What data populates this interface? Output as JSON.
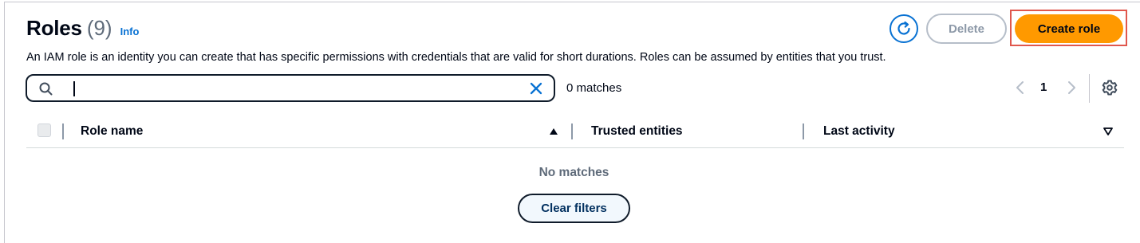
{
  "header": {
    "title": "Roles",
    "count": "(9)",
    "info_label": "Info",
    "description": "An IAM role is an identity you can create that has specific permissions with credentials that are valid for short durations. Roles can be assumed by entities that you trust."
  },
  "actions": {
    "refresh_icon": "refresh-icon",
    "delete_label": "Delete",
    "create_label": "Create role"
  },
  "search": {
    "value": "",
    "placeholder": "",
    "matches_text": "0 matches"
  },
  "pagination": {
    "current_page": "1"
  },
  "table": {
    "columns": [
      {
        "label": "Role name",
        "sort": "ascending"
      },
      {
        "label": "Trusted entities"
      },
      {
        "label": "Last activity"
      }
    ],
    "empty_text": "No matches",
    "clear_filters_label": "Clear filters"
  },
  "colors": {
    "primary_button": "#ff9900",
    "link": "#0972d3",
    "highlight_border": "#e0574d",
    "disabled": "#8d99a8"
  }
}
